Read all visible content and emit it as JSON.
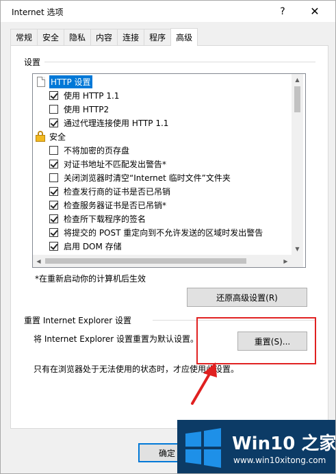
{
  "window": {
    "title": "Internet 选项",
    "help_glyph": "?",
    "close_glyph": "✕"
  },
  "tabs": [
    {
      "label": "常规",
      "active": false
    },
    {
      "label": "安全",
      "active": false
    },
    {
      "label": "隐私",
      "active": false
    },
    {
      "label": "内容",
      "active": false
    },
    {
      "label": "连接",
      "active": false
    },
    {
      "label": "程序",
      "active": false
    },
    {
      "label": "高级",
      "active": true
    }
  ],
  "settings": {
    "group_label": "设置",
    "items": [
      {
        "type": "category",
        "icon": "document-icon",
        "label": "HTTP 设置",
        "selected": true
      },
      {
        "type": "checkbox",
        "label": "使用 HTTP 1.1",
        "checked": true
      },
      {
        "type": "checkbox",
        "label": "使用 HTTP2",
        "checked": false
      },
      {
        "type": "checkbox",
        "label": "通过代理连接使用 HTTP 1.1",
        "checked": true
      },
      {
        "type": "category",
        "icon": "lock-icon",
        "label": "安全",
        "selected": false
      },
      {
        "type": "checkbox",
        "label": "不将加密的页存盘",
        "checked": false
      },
      {
        "type": "checkbox",
        "label": "对证书地址不匹配发出警告*",
        "checked": true
      },
      {
        "type": "checkbox",
        "label": "关闭浏览器时清空“Internet 临时文件”文件夹",
        "checked": false
      },
      {
        "type": "checkbox",
        "label": "检查发行商的证书是否已吊销",
        "checked": true
      },
      {
        "type": "checkbox",
        "label": "检查服务器证书是否已吊销*",
        "checked": true
      },
      {
        "type": "checkbox",
        "label": "检查所下载程序的签名",
        "checked": true
      },
      {
        "type": "checkbox",
        "label": "将提交的 POST 重定向到不允许发送的区域时发出警告",
        "checked": true
      },
      {
        "type": "checkbox",
        "label": "启用 DOM 存储",
        "checked": true
      }
    ],
    "restart_note": "*在重新启动你的计算机后生效",
    "restore_button": "还原高级设置(R)"
  },
  "reset": {
    "group_label": "重置 Internet Explorer 设置",
    "description": "将 Internet Explorer 设置重置为默认设置。",
    "button": "重置(S)...",
    "warning": "只有在浏览器处于无法使用的状态时，才应使用此设置。"
  },
  "footer": {
    "ok_button": "确定"
  },
  "watermark": {
    "title": "Win10 之家",
    "url": "www.win10xitong.com"
  },
  "colors": {
    "selection": "#0078d7",
    "annotation_red": "#e02020",
    "watermark_bg": "#0c3b66",
    "logo_blue": "#1e90e8"
  }
}
